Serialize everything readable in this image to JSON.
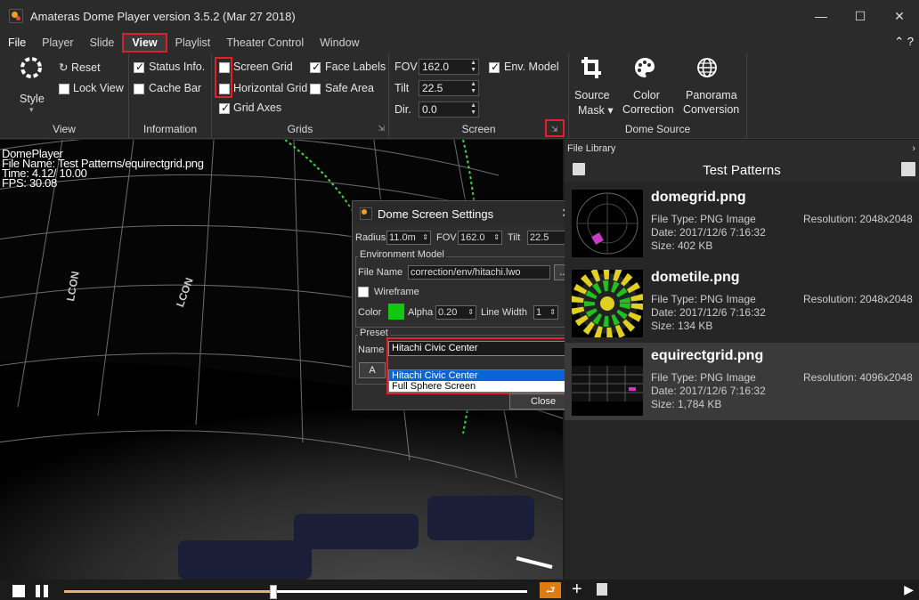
{
  "window": {
    "title": "Amateras Dome Player version 3.5.2 (Mar 27 2018)",
    "minimize": "—",
    "maximize": "☐",
    "close": "✕"
  },
  "menu": {
    "items": [
      "File",
      "Player",
      "Slide",
      "View",
      "Playlist",
      "Theater Control",
      "Window"
    ],
    "active": "View",
    "right_icons": "⌃ ?"
  },
  "ribbon": {
    "view": {
      "style_label": "Style",
      "reset_label": "Reset",
      "lock_view_label": "Lock View",
      "group_label": "View"
    },
    "information": {
      "status_info_label": "Status Info.",
      "status_info_checked": true,
      "cache_bar_label": "Cache Bar",
      "cache_bar_checked": false,
      "group_label": "Information"
    },
    "grids": {
      "screen_grid_label": "Screen Grid",
      "screen_grid_checked": false,
      "face_labels_label": "Face Labels",
      "face_labels_checked": true,
      "horizontal_grid_label": "Horizontal Grid",
      "horizontal_grid_checked": false,
      "safe_area_label": "Safe Area",
      "safe_area_checked": false,
      "grid_axes_label": "Grid Axes",
      "grid_axes_checked": true,
      "group_label": "Grids"
    },
    "screen": {
      "fov_label": "FOV",
      "fov_value": "162.0",
      "tilt_label": "Tilt",
      "tilt_value": "22.5",
      "dir_label": "Dir.",
      "dir_value": "0.0",
      "env_model_label": "Env. Model",
      "env_model_checked": true,
      "group_label": "Screen"
    },
    "dome_source": {
      "source_mask_label": "Source",
      "source_mask_label2": "Mask",
      "color_correction_label": "Color",
      "color_correction_label2": "Correction",
      "panorama_label": "Panorama",
      "panorama_label2": "Conversion",
      "group_label": "Dome Source"
    }
  },
  "viewport": {
    "hud_line1": "DomePlayer",
    "hud_line2": "File Name: Test Patterns/equirectgrid.png",
    "hud_line3": "Time:    4.12/  10.00",
    "hud_line4": "FPS: 30.08",
    "label_a": "LCON",
    "label_b": "LCON"
  },
  "dialog": {
    "title": "Dome Screen Settings",
    "radius_label": "Radius",
    "radius_value": "11.0m",
    "fov_label": "FOV",
    "fov_value": "162.0",
    "tilt_label": "Tilt",
    "tilt_value": "22.5",
    "env_group": "Environment Model",
    "file_name_label": "File Name",
    "file_name_value": "correction/env/hitachi.lwo",
    "browse_label": "...",
    "wireframe_label": "Wireframe",
    "wireframe_checked": false,
    "color_label": "Color",
    "color_swatch": "#10c810",
    "alpha_label": "Alpha",
    "alpha_value": "0.20",
    "line_width_label": "Line Width",
    "line_width_value": "1",
    "preset_group": "Preset",
    "name_label": "Name",
    "preset_selected": "Hitachi Civic Center",
    "preset_options": [
      "Hitachi Civic Center",
      "Full Sphere Screen"
    ],
    "apply_label": "A",
    "close_label": "Close"
  },
  "transport": {
    "progress": 0.452
  },
  "library": {
    "panel_title": "File Library",
    "collapse": "›",
    "folder_title": "Test Patterns",
    "items": [
      {
        "name": "domegrid.png",
        "type": "File Type: PNG Image",
        "date": "Date: 2017/12/6 7:16:32",
        "size": "Size: 402 KB",
        "res": "Resolution: 2048x2048"
      },
      {
        "name": "dometile.png",
        "type": "File Type: PNG Image",
        "date": "Date: 2017/12/6 7:16:32",
        "size": "Size: 134 KB",
        "res": "Resolution: 2048x2048"
      },
      {
        "name": "equirectgrid.png",
        "type": "File Type: PNG Image",
        "date": "Date: 2017/12/6 7:16:32",
        "size": "Size: 1,784 KB",
        "res": "Resolution: 4096x2048"
      }
    ]
  },
  "colors": {
    "accent_red": "#e0202a",
    "loop_orange": "#e07b10",
    "progress_fill": "#e8b06a",
    "selection_blue": "#0a64d6"
  }
}
